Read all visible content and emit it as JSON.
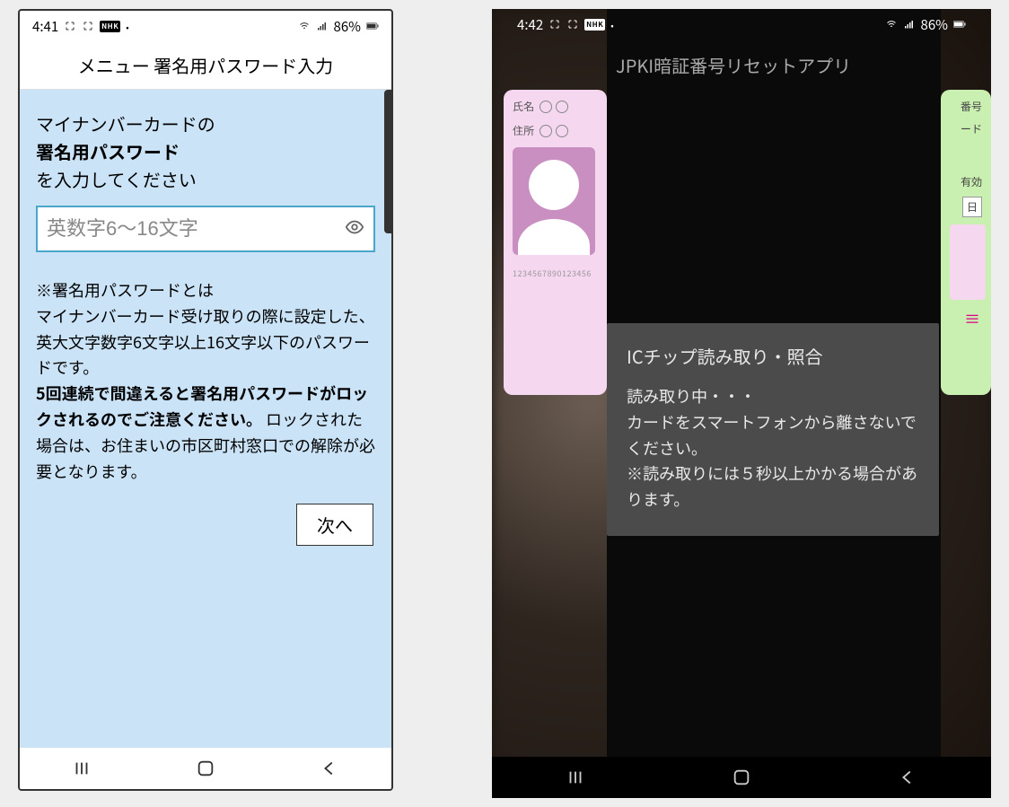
{
  "left": {
    "status": {
      "time": "4:41",
      "nhk": "NHK",
      "battery": "86%"
    },
    "header": "メニュー 署名用パスワード入力",
    "intro_line1": "マイナンバーカードの",
    "intro_line2_bold": "署名用パスワード",
    "intro_line3": "を入力してください",
    "input_placeholder": "英数字6〜16文字",
    "note_line1": "※署名用パスワードとは",
    "note_line2": "マイナンバーカード受け取りの際に設定した、英大文字数字6文字以上16文字以下のパスワードです。",
    "note_line3_bold": "5回連続で間違えると署名用パスワードがロックされるのでご注意ください。",
    "note_line4": "ロックされた場合は、お住まいの市区町村窓口での解除が必要となります。",
    "next_label": "次へ"
  },
  "right": {
    "status": {
      "time": "4:42",
      "nhk": "NHK",
      "battery": "86%"
    },
    "app_title": "JPKI暗証番号リセットアプリ",
    "card_left": {
      "name_label": "氏名",
      "addr_label": "住所",
      "card_number": "1234567890123456"
    },
    "card_right": {
      "t1": "番号",
      "t2": "ード",
      "t3": "有効",
      "t4": "日"
    },
    "dialog": {
      "title": "ICチップ読み取り・照合",
      "msg_line1": "読み取り中・・・",
      "msg_line2": "カードをスマートフォンから離さないでください。",
      "msg_line3": "※読み取りには５秒以上かかる場合があります。"
    }
  }
}
